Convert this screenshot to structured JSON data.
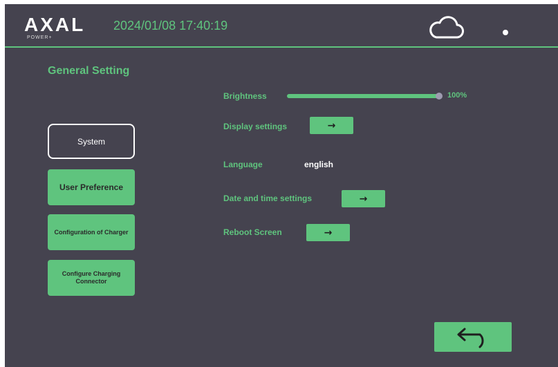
{
  "header": {
    "logo_text": "AXAL",
    "logo_sub": "POWER+",
    "datetime": "2024/01/08 17:40:19",
    "cloud_icon": "cloud-icon",
    "status_icon": "status-dot-icon"
  },
  "section_title": "General Setting",
  "sidebar": {
    "items": [
      {
        "label": "System",
        "active": true
      },
      {
        "label": "User Preference",
        "active": false
      },
      {
        "label": "Configuration of Charger",
        "active": false
      },
      {
        "label": "Configure Charging Connector",
        "active": false
      }
    ]
  },
  "settings": {
    "brightness_label": "Brightness",
    "brightness_value": "100%",
    "brightness_level": 1.0,
    "display_label": "Display settings",
    "language_label": "Language",
    "language_value": "english",
    "datetime_label": "Date and time settings",
    "reboot_label": "Reboot Screen",
    "arrow_symbol": "→"
  },
  "back_icon": "back-arrow-icon",
  "colors": {
    "background": "#45434f",
    "accent": "#5fc47e",
    "text_light": "#ffffff"
  }
}
